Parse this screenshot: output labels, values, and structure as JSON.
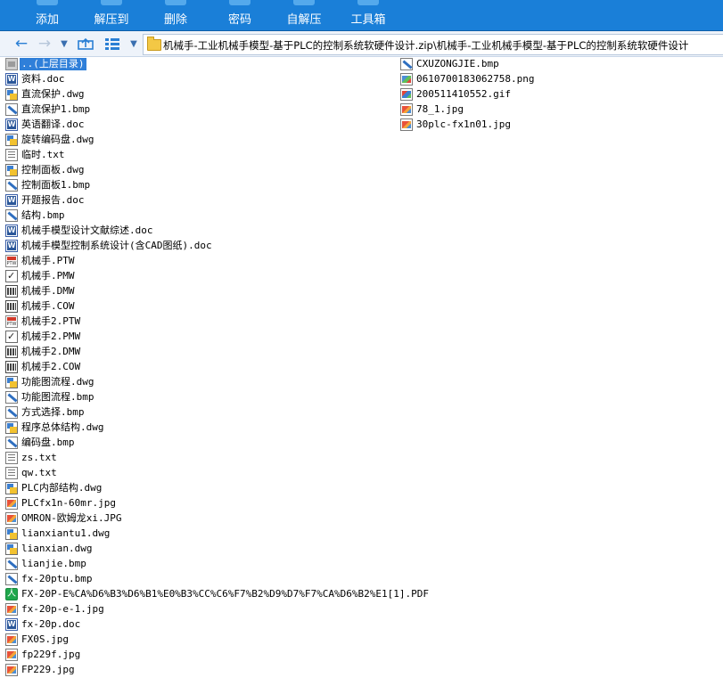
{
  "toolbar": {
    "buttons": [
      {
        "label": "添加"
      },
      {
        "label": "解压到"
      },
      {
        "label": "删除"
      },
      {
        "label": "密码"
      },
      {
        "label": "自解压"
      },
      {
        "label": "工具箱"
      }
    ]
  },
  "navbar": {
    "path": "机械手-工业机械手模型-基于PLC的控制系统软硬件设计.zip\\机械手-工业机械手模型-基于PLC的控制系统软硬件设计"
  },
  "files_col1": [
    {
      "name": "..(上层目录)",
      "icon": "folder-up-icon",
      "type": "up",
      "selected": true
    },
    {
      "name": "资料.doc",
      "icon": "word-doc-icon",
      "type": "doc"
    },
    {
      "name": "直流保护.dwg",
      "icon": "dwg-file-icon",
      "type": "dwg"
    },
    {
      "name": "直流保护1.bmp",
      "icon": "bmp-image-icon",
      "type": "bmp"
    },
    {
      "name": "英语翻译.doc",
      "icon": "word-doc-icon",
      "type": "doc"
    },
    {
      "name": "旋转编码盘.dwg",
      "icon": "dwg-file-icon",
      "type": "dwg"
    },
    {
      "name": "临时.txt",
      "icon": "text-file-icon",
      "type": "txt"
    },
    {
      "name": "控制面板.dwg",
      "icon": "dwg-file-icon",
      "type": "dwg"
    },
    {
      "name": "控制面板1.bmp",
      "icon": "bmp-image-icon",
      "type": "bmp"
    },
    {
      "name": "开题报告.doc",
      "icon": "word-doc-icon",
      "type": "doc"
    },
    {
      "name": "结构.bmp",
      "icon": "bmp-image-icon",
      "type": "bmp"
    },
    {
      "name": "机械手模型设计文献综述.doc",
      "icon": "word-doc-icon",
      "type": "doc"
    },
    {
      "name": "机械手模型控制系统设计(含CAD图纸).doc",
      "icon": "word-doc-icon",
      "type": "doc"
    },
    {
      "name": "机械手.PTW",
      "icon": "ptw-file-icon",
      "type": "ptw"
    },
    {
      "name": "机械手.PMW",
      "icon": "pmw-file-icon",
      "type": "pmw"
    },
    {
      "name": "机械手.DMW",
      "icon": "dmw-file-icon",
      "type": "dmw"
    },
    {
      "name": "机械手.COW",
      "icon": "dmw-file-icon",
      "type": "dmw"
    },
    {
      "name": "机械手2.PTW",
      "icon": "ptw-file-icon",
      "type": "ptw"
    },
    {
      "name": "机械手2.PMW",
      "icon": "pmw-file-icon",
      "type": "pmw"
    },
    {
      "name": "机械手2.DMW",
      "icon": "dmw-file-icon",
      "type": "dmw"
    },
    {
      "name": "机械手2.COW",
      "icon": "dmw-file-icon",
      "type": "dmw"
    },
    {
      "name": "功能图流程.dwg",
      "icon": "dwg-file-icon",
      "type": "dwg"
    },
    {
      "name": "功能图流程.bmp",
      "icon": "bmp-image-icon",
      "type": "bmp"
    },
    {
      "name": "方式选择.bmp",
      "icon": "bmp-image-icon",
      "type": "bmp"
    },
    {
      "name": "程序总体结构.dwg",
      "icon": "dwg-file-icon",
      "type": "dwg"
    },
    {
      "name": "编码盘.bmp",
      "icon": "bmp-image-icon",
      "type": "bmp"
    },
    {
      "name": "zs.txt",
      "icon": "text-file-icon",
      "type": "txt"
    },
    {
      "name": "qw.txt",
      "icon": "text-file-icon",
      "type": "txt"
    },
    {
      "name": "PLC内部结构.dwg",
      "icon": "dwg-file-icon",
      "type": "dwg"
    },
    {
      "name": "PLCfx1n-60mr.jpg",
      "icon": "jpg-image-icon",
      "type": "jpg"
    },
    {
      "name": "OMRON-欧姆龙xi.JPG",
      "icon": "jpg-image-icon",
      "type": "jpg"
    },
    {
      "name": "lianxiantu1.dwg",
      "icon": "dwg-file-icon",
      "type": "dwg"
    },
    {
      "name": "lianxian.dwg",
      "icon": "dwg-file-icon",
      "type": "dwg"
    },
    {
      "name": "lianjie.bmp",
      "icon": "bmp-image-icon",
      "type": "bmp"
    },
    {
      "name": "fx-20ptu.bmp",
      "icon": "bmp-image-icon",
      "type": "bmp"
    },
    {
      "name": "FX-20P-E%CA%D6%B3%D6%B1%E0%B3%CC%C6%F7%B2%D9%D7%F7%CA%D6%B2%E1[1].PDF",
      "icon": "pdf-file-icon",
      "type": "pdf"
    },
    {
      "name": "fx-20p-e-1.jpg",
      "icon": "jpg-image-icon",
      "type": "jpg"
    },
    {
      "name": "fx-20p.doc",
      "icon": "word-doc-icon",
      "type": "doc"
    },
    {
      "name": "FX0S.jpg",
      "icon": "jpg-image-icon",
      "type": "jpg"
    },
    {
      "name": "fp229f.jpg",
      "icon": "jpg-image-icon",
      "type": "jpg"
    },
    {
      "name": "FP229.jpg",
      "icon": "jpg-image-icon",
      "type": "jpg"
    }
  ],
  "files_col2": [
    {
      "name": "CXUZONGJIE.bmp",
      "icon": "bmp-image-icon",
      "type": "bmp"
    },
    {
      "name": "0610700183062758.png",
      "icon": "png-image-icon",
      "type": "png"
    },
    {
      "name": "200511410552.gif",
      "icon": "gif-image-icon",
      "type": "gif"
    },
    {
      "name": "78_1.jpg",
      "icon": "jpg-image-icon",
      "type": "jpg"
    },
    {
      "name": "30plc-fx1n01.jpg",
      "icon": "jpg-image-icon",
      "type": "jpg"
    }
  ]
}
